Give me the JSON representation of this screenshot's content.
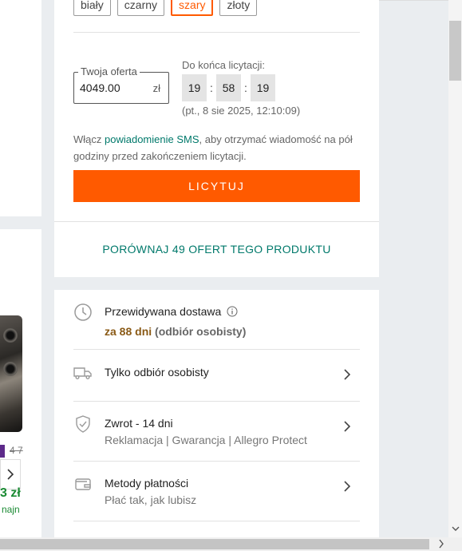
{
  "color_options": [
    {
      "label": "biały",
      "selected": false
    },
    {
      "label": "czarny",
      "selected": false
    },
    {
      "label": "szary",
      "selected": true
    },
    {
      "label": "złoty",
      "selected": false
    }
  ],
  "offer": {
    "label": "Twoja oferta",
    "value": "4049.00",
    "currency": "zł"
  },
  "timer": {
    "label": "Do końca licytacji:",
    "hours": "19",
    "minutes": "58",
    "seconds": "19",
    "separator": ":",
    "end_date": "(pt., 8 sie 2025, 12:10:09)"
  },
  "sms": {
    "prefix": "Włącz ",
    "link": "powiadomienie SMS",
    "suffix": ", aby otrzymać wiadomość na pół godziny przed zakończeniem licytacji."
  },
  "bid_button": "LICYTUJ",
  "compare_link": "PORÓWNAJ 49 OFERT TEGO PRODUKTU",
  "delivery": {
    "title": "Przewidywana dostawa",
    "eta_bold": "za 88 dni",
    "eta_rest": " (odbiór osobisty)"
  },
  "rows": [
    {
      "title": "Tylko odbiór osobisty",
      "subtitle": ""
    },
    {
      "title": "Zwrot - 14 dni",
      "subtitle": "Reklamacja | Gwarancja | Allegro Protect"
    },
    {
      "title": "Metody płatności",
      "subtitle": "Płać tak, jak lubisz"
    }
  ],
  "left_panel": {
    "old_price": "4 7",
    "price": "3 zł",
    "note": "najn"
  },
  "colors": {
    "accent": "#ff5a00",
    "link": "#00796b",
    "eta": "#8a5a16"
  },
  "icons": [
    "clock-icon",
    "info-icon",
    "truck-icon",
    "shield-check-icon",
    "wallet-icon",
    "chevron-right-icon"
  ]
}
